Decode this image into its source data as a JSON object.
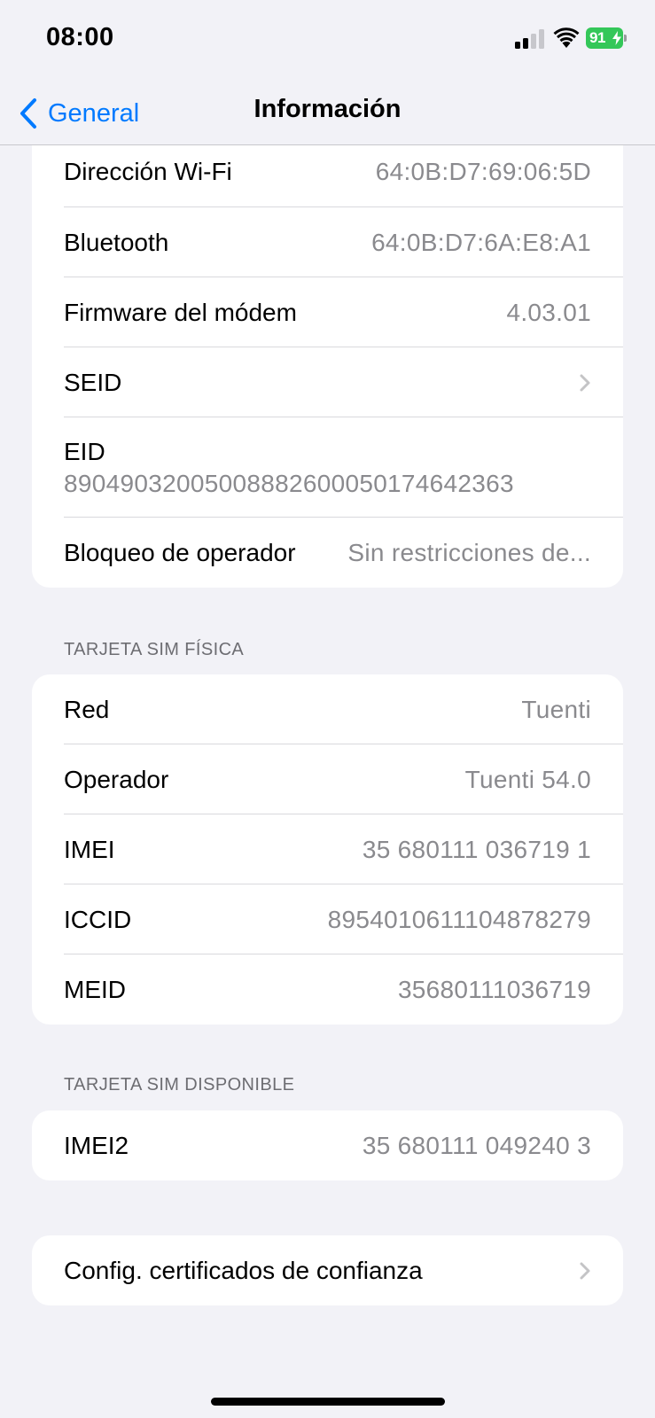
{
  "status_bar": {
    "time": "08:00",
    "battery": "91",
    "signal_icon": "cellular-signal-icon",
    "wifi_icon": "wifi-icon",
    "battery_color": "#34c759"
  },
  "nav": {
    "back_label": "General",
    "title": "Información",
    "accent": "#007aff"
  },
  "group1": {
    "rows": [
      {
        "label": "Dirección Wi-Fi",
        "value": "64:0B:D7:69:06:5D"
      },
      {
        "label": "Bluetooth",
        "value": "64:0B:D7:6A:E8:A1"
      },
      {
        "label": "Firmware del módem",
        "value": "4.03.01"
      },
      {
        "label": "SEID"
      },
      {
        "label": "EID",
        "value": "89049032005008882600050174642363"
      },
      {
        "label": "Bloqueo de operador",
        "value": "Sin restricciones de..."
      }
    ]
  },
  "physical_sim": {
    "header": "TARJETA SIM FÍSICA",
    "rows": [
      {
        "label": "Red",
        "value": "Tuenti"
      },
      {
        "label": "Operador",
        "value": "Tuenti 54.0"
      },
      {
        "label": "IMEI",
        "value": "35 680111 036719 1"
      },
      {
        "label": "ICCID",
        "value": "8954010611104878279"
      },
      {
        "label": "MEID",
        "value": "35680111036719"
      }
    ]
  },
  "available_sim": {
    "header": "TARJETA SIM DISPONIBLE",
    "rows": [
      {
        "label": "IMEI2",
        "value": "35 680111 049240 3"
      }
    ]
  },
  "certificates": {
    "label": "Config. certificados de confianza"
  }
}
